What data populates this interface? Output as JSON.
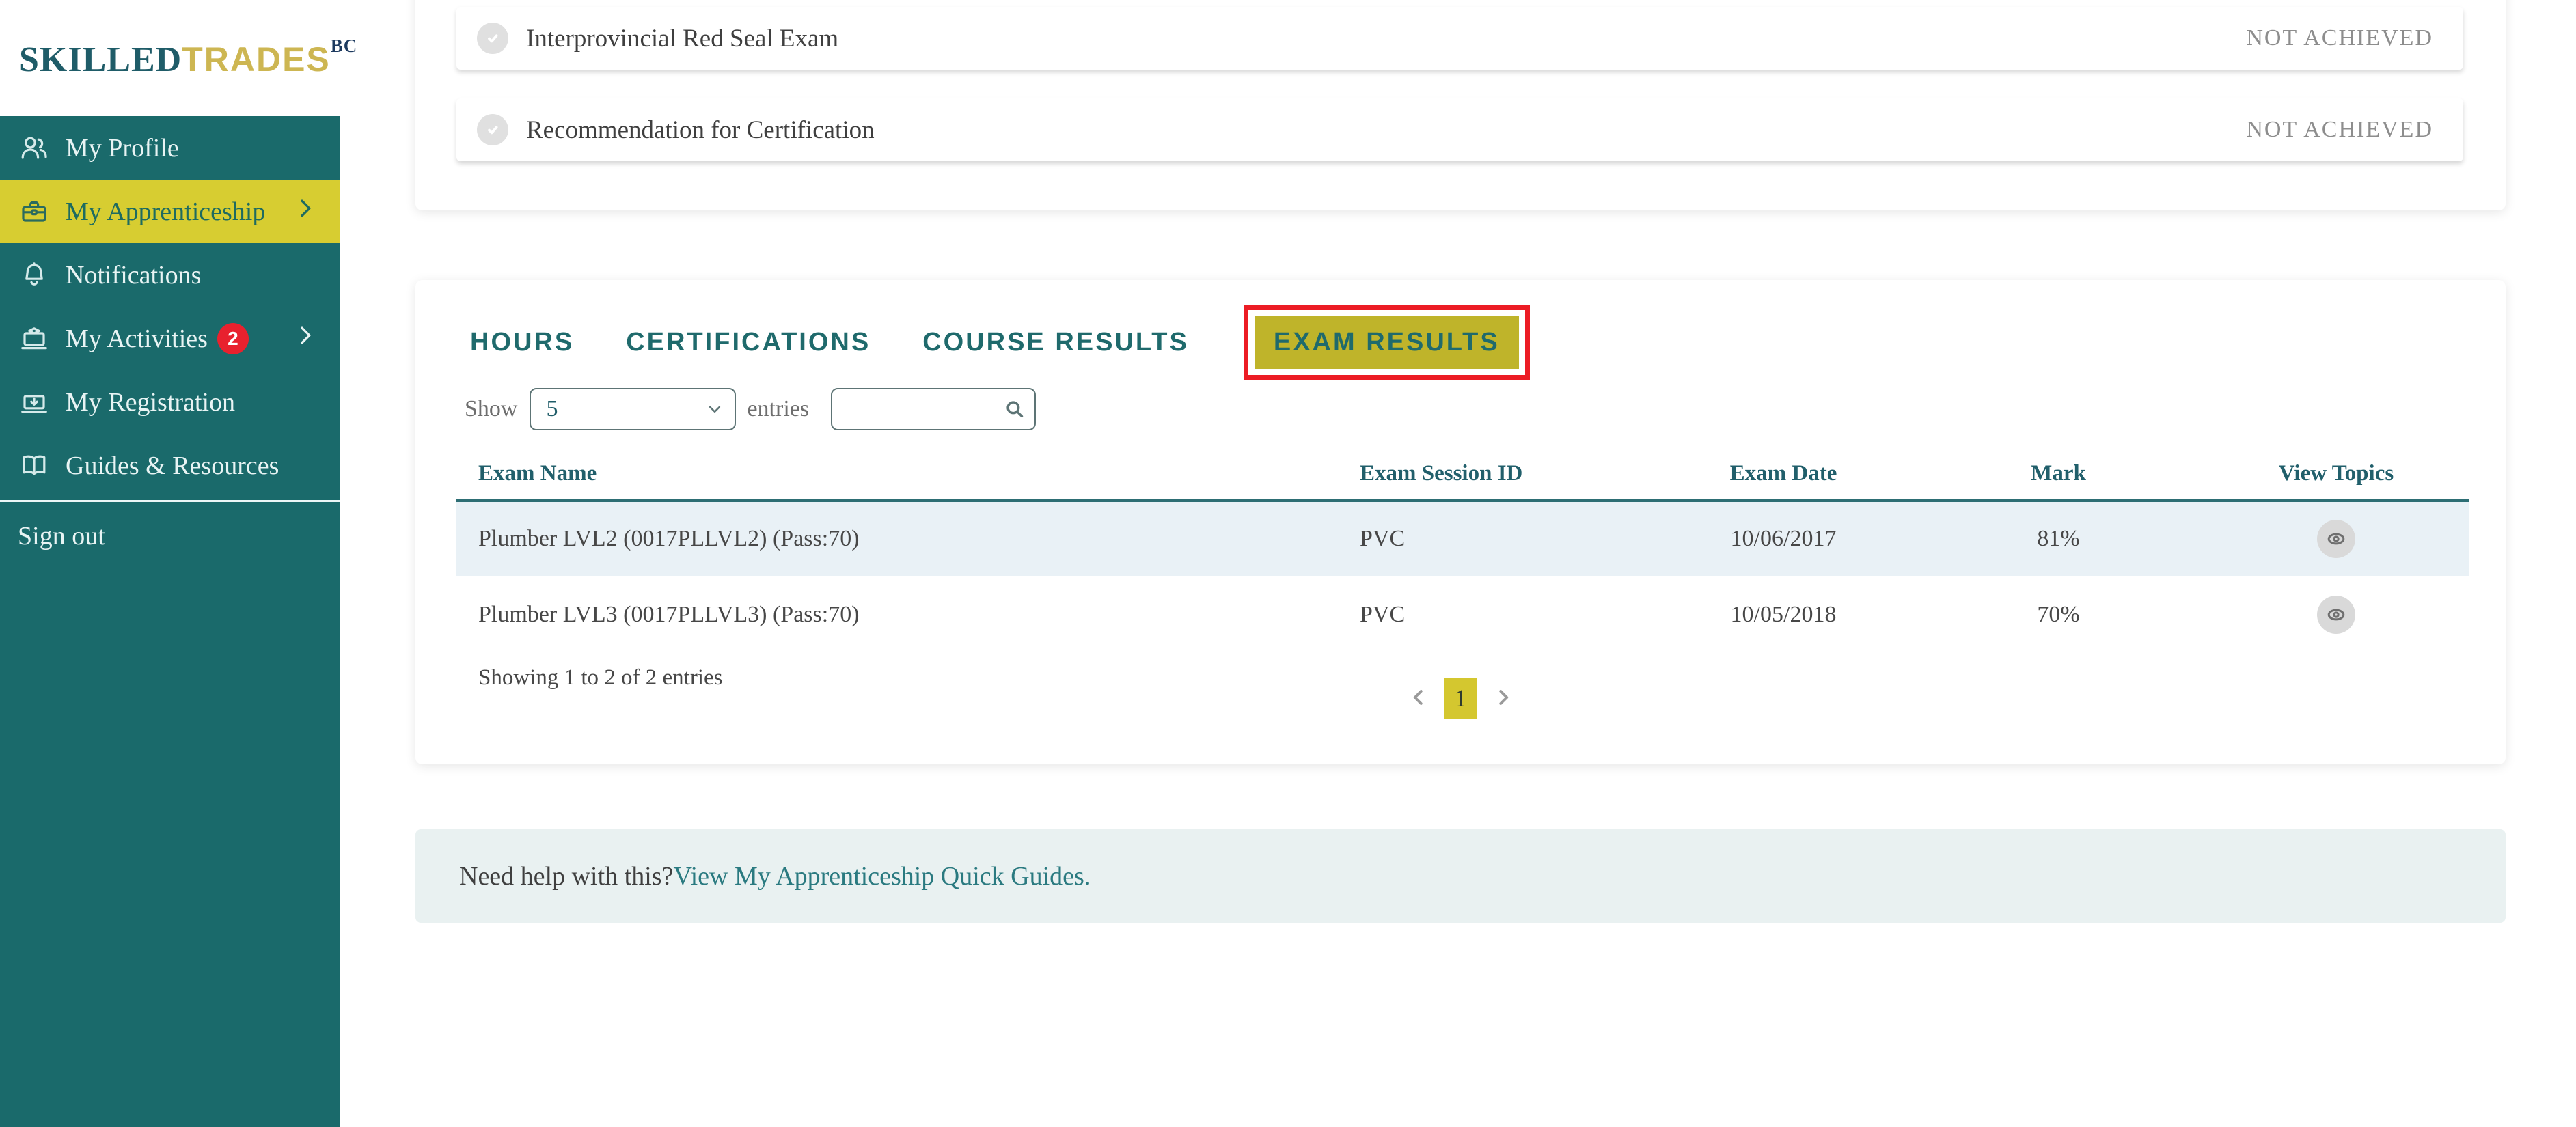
{
  "brand": {
    "skilled": "SKILLED",
    "trades": "TRADES",
    "bc": "BC"
  },
  "sidebar": {
    "items": [
      {
        "label": "My Profile",
        "icon": "profile-icon",
        "active": false,
        "expandable": false
      },
      {
        "label": "My Apprenticeship",
        "icon": "briefcase-icon",
        "active": true,
        "expandable": true
      },
      {
        "label": "Notifications",
        "icon": "bell-icon",
        "active": false,
        "expandable": false
      },
      {
        "label": "My Activities",
        "icon": "activities-icon",
        "active": false,
        "expandable": true,
        "badge": "2"
      },
      {
        "label": "My Registration",
        "icon": "registration-icon",
        "active": false,
        "expandable": false
      },
      {
        "label": "Guides & Resources",
        "icon": "book-icon",
        "active": false,
        "expandable": false
      }
    ],
    "sign_out": "Sign out"
  },
  "achievements": {
    "rows": [
      {
        "label": "Interprovincial Red Seal Exam",
        "status": "NOT ACHIEVED"
      },
      {
        "label": "Recommendation for Certification",
        "status": "NOT ACHIEVED"
      }
    ]
  },
  "results_card": {
    "tabs": [
      {
        "label": "HOURS",
        "active": false
      },
      {
        "label": "CERTIFICATIONS",
        "active": false
      },
      {
        "label": "COURSE RESULTS",
        "active": false
      },
      {
        "label": "EXAM RESULTS",
        "active": true,
        "annotated": true
      }
    ],
    "show_label": "Show",
    "page_size": "5",
    "entries_label": "entries",
    "search_value": "",
    "table": {
      "columns": [
        "Exam Name",
        "Exam Session ID",
        "Exam Date",
        "Mark",
        "View Topics"
      ],
      "rows": [
        {
          "exam_name": "Plumber LVL2 (0017PLLVL2) (Pass:70)",
          "session_id": "PVC",
          "exam_date": "10/06/2017",
          "mark": "81%"
        },
        {
          "exam_name": "Plumber LVL3 (0017PLLVL3) (Pass:70)",
          "session_id": "PVC",
          "exam_date": "10/05/2018",
          "mark": "70%"
        }
      ]
    },
    "summary": "Showing 1 to 2 of 2 entries",
    "pagination": {
      "current_page": "1"
    }
  },
  "help": {
    "prefix": "Need help with this? ",
    "link": "View My Apprenticeship Quick Guides."
  },
  "colors": {
    "sidebar_teal": "#1a6a6b",
    "active_yellow": "#d7cd31",
    "tab_highlight_yellow": "#bfb42a",
    "annotation_red": "#ec1c24",
    "badge_red": "#e8212e",
    "teal_text": "#1f6a6c",
    "link_teal": "#2a7a80",
    "status_grey": "#8d8d8d",
    "row_alt_blue": "#e9f1f6",
    "logo_gold": "#cdb652",
    "logo_teal": "#1f5c68"
  }
}
